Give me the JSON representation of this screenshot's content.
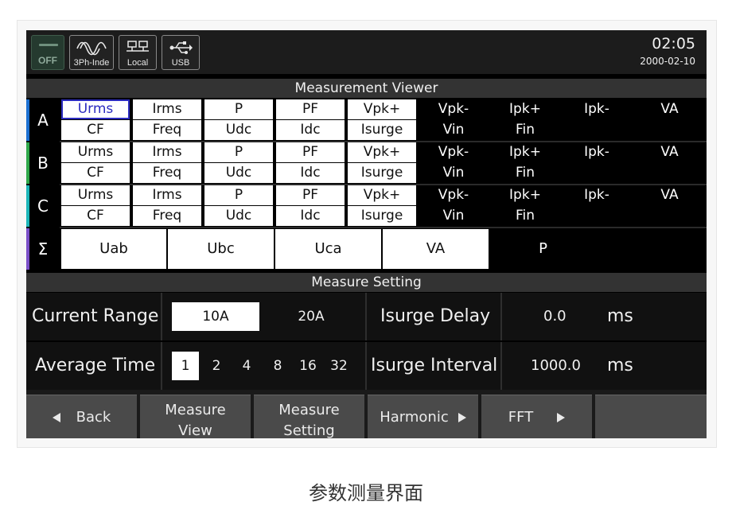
{
  "statusbar": {
    "off_label": "OFF",
    "mode_label": "3Ph-Inde",
    "local_label": "Local",
    "usb_label": "USB",
    "time": "02:05",
    "date": "2000-02-10"
  },
  "measurement_viewer": {
    "title": "Measurement Viewer",
    "phases": [
      {
        "name": "A",
        "color": "#1b6fd1",
        "row1": [
          "Urms",
          "Irms",
          "P",
          "PF",
          "Vpk+",
          "Vpk-",
          "Ipk+",
          "Ipk-",
          "VA"
        ],
        "row2": [
          "CF",
          "Freq",
          "Udc",
          "Idc",
          "Isurge",
          "Vin",
          "Fin",
          "",
          ""
        ]
      },
      {
        "name": "B",
        "color": "#2fa84a",
        "row1": [
          "Urms",
          "Irms",
          "P",
          "PF",
          "Vpk+",
          "Vpk-",
          "Ipk+",
          "Ipk-",
          "VA"
        ],
        "row2": [
          "CF",
          "Freq",
          "Udc",
          "Idc",
          "Isurge",
          "Vin",
          "Fin",
          "",
          ""
        ]
      },
      {
        "name": "C",
        "color": "#1bb5b8",
        "row1": [
          "Urms",
          "Irms",
          "P",
          "PF",
          "Vpk+",
          "Vpk-",
          "Ipk+",
          "Ipk-",
          "VA"
        ],
        "row2": [
          "CF",
          "Freq",
          "Udc",
          "Idc",
          "Isurge",
          "Vin",
          "Fin",
          "",
          ""
        ]
      }
    ],
    "sigma": {
      "name": "Σ",
      "color": "#7a4fc8",
      "items": [
        "Uab",
        "Ubc",
        "Uca",
        "VA",
        "P"
      ]
    }
  },
  "measure_setting": {
    "title": "Measure Setting",
    "current_range_label": "Current Range",
    "current_range_options": [
      "10A",
      "20A"
    ],
    "current_range_selected": "10A",
    "isurge_delay_label": "Isurge Delay",
    "isurge_delay_value": "0.0",
    "isurge_delay_unit": "ms",
    "average_time_label": "Average Time",
    "average_time_options": [
      "1",
      "2",
      "4",
      "8",
      "16",
      "32"
    ],
    "average_time_selected": "1",
    "isurge_interval_label": "Isurge Interval",
    "isurge_interval_value": "1000.0",
    "isurge_interval_unit": "ms"
  },
  "softkeys": {
    "back": "Back",
    "measure_view_1": "Measure",
    "measure_view_2": "View",
    "measure_setting_1": "Measure",
    "measure_setting_2": "Setting",
    "harmonic": "Harmonic",
    "fft": "FFT"
  },
  "caption": "参数测量界面"
}
